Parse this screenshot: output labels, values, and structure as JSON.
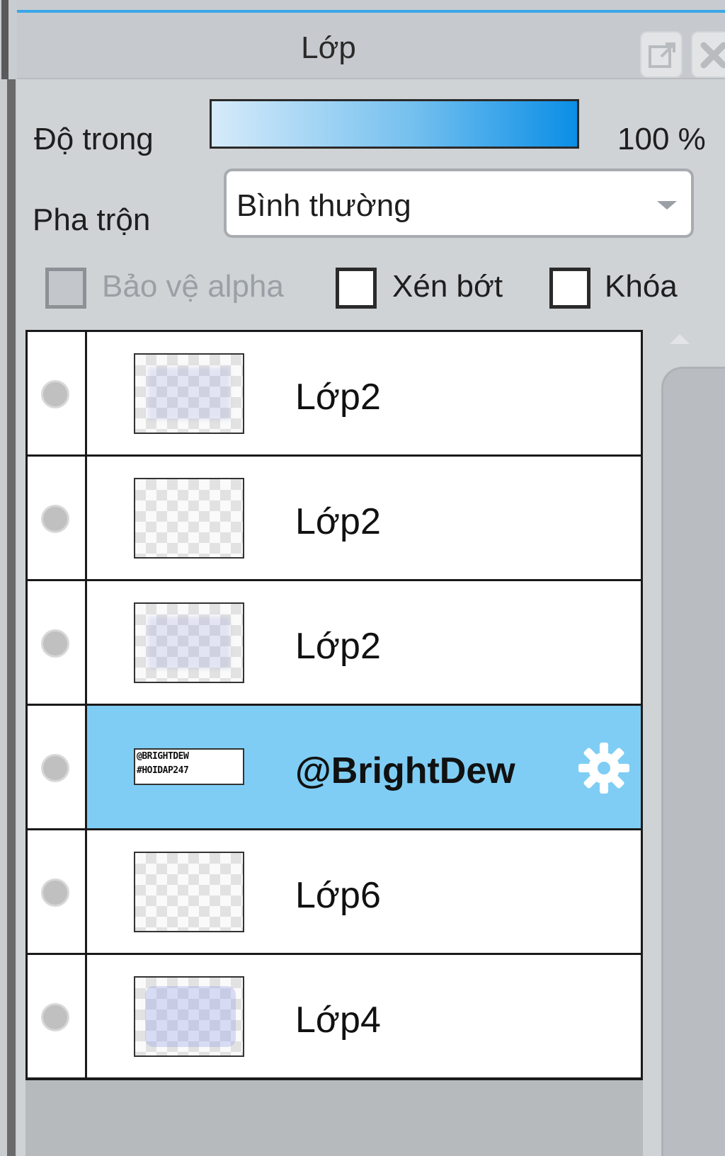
{
  "panel": {
    "title": "Lớp"
  },
  "opacity": {
    "label": "Độ trong",
    "value": "100 %",
    "level_percent": 100
  },
  "blend": {
    "label": "Pha trộn",
    "selected": "Bình thường"
  },
  "options": {
    "protect_alpha": {
      "label": "Bảo vệ alpha",
      "checked": false,
      "disabled": true
    },
    "clipping": {
      "label": "Xén bớt",
      "checked": false
    },
    "lock": {
      "label": "Khóa",
      "checked": false
    }
  },
  "layers": [
    {
      "name": "Lớp2",
      "thumb": "blue",
      "selected": false
    },
    {
      "name": "Lớp2",
      "thumb": "empty",
      "selected": false
    },
    {
      "name": "Lớp2",
      "thumb": "blue",
      "selected": false
    },
    {
      "name": "@BrightDew",
      "thumb": "text",
      "thumb_text": [
        "@BRIGHTDEW",
        "#HOIDAP247"
      ],
      "selected": true
    },
    {
      "name": "Lớp6",
      "thumb": "empty",
      "selected": false
    },
    {
      "name": "Lớp4",
      "thumb": "filled",
      "selected": false
    }
  ],
  "colors": {
    "accent": "#39a6e8",
    "selected_row": "#7fcdf4",
    "opacity_bar_end": "#0a8ee6"
  },
  "icons": {
    "popout": "popout-icon",
    "close": "close-icon",
    "settings": "gear-icon",
    "visibility": "visibility-dot-icon"
  }
}
